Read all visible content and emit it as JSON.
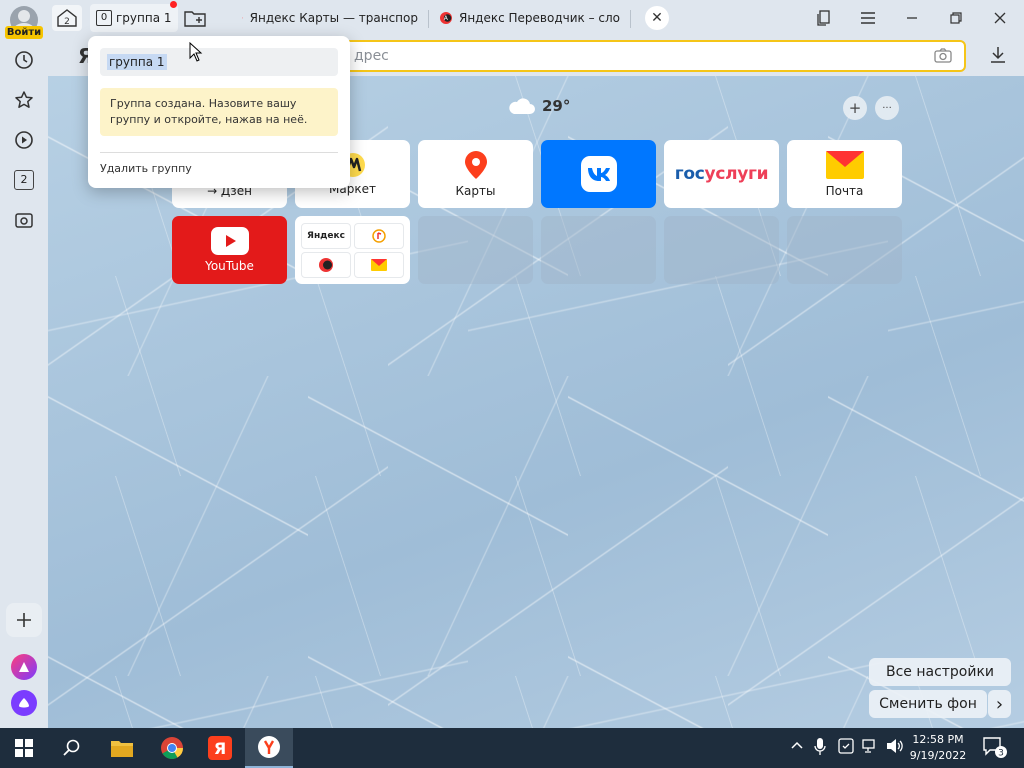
{
  "sidebar": {
    "login_label": "Войти",
    "tab_counter": "2"
  },
  "titlebar": {
    "home_counter": "2",
    "group": {
      "count": "0",
      "label": "группа 1"
    },
    "tabs": [
      {
        "title": "Яндекс Карты — транспор"
      },
      {
        "title": "Яндекс Переводчик – сло"
      }
    ],
    "close_symbol": "✕"
  },
  "toolbar": {
    "logo": "Я",
    "address_placeholder": "дрес"
  },
  "content": {
    "weather": {
      "temperature": "29°"
    },
    "add_symbol": "+",
    "more_symbol": "···",
    "tiles": [
      {
        "label": "→ Дзен"
      },
      {
        "label": "Маркет"
      },
      {
        "label": "Карты"
      },
      {
        "label": ""
      },
      {
        "label": "госуслуги"
      },
      {
        "label": "Почта"
      },
      {
        "label": "YouTube"
      }
    ],
    "mini_tiles": {
      "yandex": "Яндекс"
    },
    "all_settings": "Все настройки",
    "change_background": "Сменить фон",
    "chevron": "›"
  },
  "popup": {
    "group_name": "группа 1",
    "note": "Группа создана. Назовите вашу группу и откройте, нажав на неё.",
    "delete_label": "Удалить группу"
  },
  "taskbar": {
    "time": "12:58 PM",
    "date": "9/19/2022",
    "notifications": "3"
  },
  "colors": {
    "accent_yellow": "#f5c518",
    "vk_blue": "#0077ff",
    "youtube_red": "#e31a1a",
    "gosuslugi_blue": "#1a5dab",
    "gosuslugi_red": "#ee3f58"
  }
}
